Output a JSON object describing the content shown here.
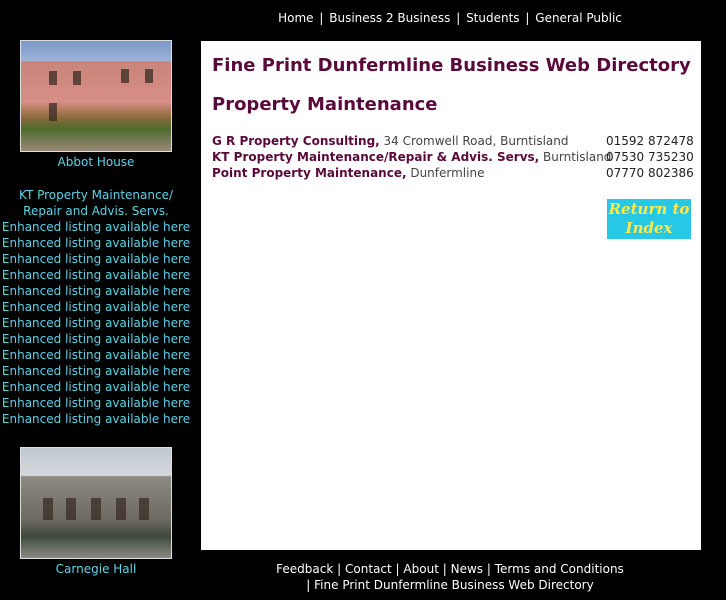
{
  "nav": {
    "items": [
      "Home",
      "Business 2 Business",
      "Students",
      "General Public"
    ],
    "separator": "|"
  },
  "left": {
    "top_image_caption": "Abbot House",
    "listing_title": "KT Property Maintenance/ Repair and Advis. Servs.",
    "enhanced_text": "Enhanced listing available here",
    "bottom_image_caption": "Carnegie Hall"
  },
  "main": {
    "title": "Fine Print Dunfermline Business Web Directory",
    "category": "Property Maintenance",
    "listings": [
      {
        "name": "G R Property Consulting,",
        "address": " 34 Cromwell Road, Burntisland",
        "phone": "01592 872478"
      },
      {
        "name": "KT Property Maintenance/Repair & Advis. Servs,",
        "address": " Burntisland",
        "phone": "07530 735230"
      },
      {
        "name": "Point Property Maintenance,",
        "address": " Dunfermline",
        "phone": "07770 802386"
      }
    ],
    "return_button": "Return to Index"
  },
  "footer": {
    "links": [
      "Feedback",
      "Contact",
      "About",
      "News",
      "Terms and Conditions"
    ],
    "site_name": "| Fine Print Dunfermline Business Web Directory"
  },
  "colors": {
    "background": "#000000",
    "accent_cyan": "#5fd3e8",
    "heading": "#5a0a3a",
    "button_bg": "#26c8e6",
    "button_text": "#ffe94a"
  }
}
